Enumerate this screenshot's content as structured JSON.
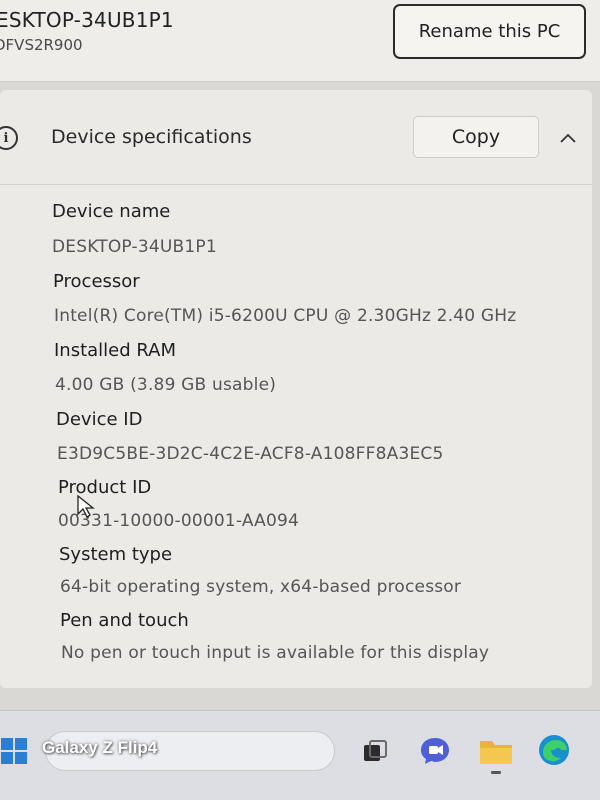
{
  "header": {
    "pc_name": "ESKTOP-34UB1P1",
    "model": "DFVS2R900",
    "rename_button": "Rename this PC"
  },
  "device_specs": {
    "title": "Device specifications",
    "copy_button": "Copy",
    "items": [
      {
        "label": "Device name",
        "value": "DESKTOP-34UB1P1"
      },
      {
        "label": "Processor",
        "value": "Intel(R) Core(TM) i5-6200U CPU @ 2.30GHz   2.40 GHz"
      },
      {
        "label": "Installed RAM",
        "value": "4.00 GB (3.89 GB usable)"
      },
      {
        "label": "Device ID",
        "value": "E3D9C5BE-3D2C-4C2E-ACF8-A108FF8A3EC5"
      },
      {
        "label": "Product ID",
        "value": "00331-10000-00001-AA094"
      },
      {
        "label": "System type",
        "value": "64-bit operating system, x64-based processor"
      },
      {
        "label": "Pen and touch",
        "value": "No pen or touch input is available for this display"
      }
    ]
  },
  "taskbar": {
    "watermark": "Galaxy Z Flip4"
  },
  "colors": {
    "window_bg": "#ebeae6",
    "taskbar_bg": "#dcdee3",
    "windows_logo": "#2a7fd4",
    "folder": "#e9b43c",
    "edge": "#1a8fd0"
  }
}
